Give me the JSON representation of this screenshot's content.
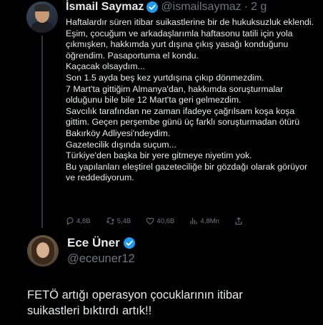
{
  "tweet1": {
    "display_name": "İsmail Saymaz",
    "handle": "@ismailsaymaz",
    "separator": "·",
    "time": "2 g",
    "paragraphs": [
      "Haftalardır süren itibar suikastlerine bir de hukuksuzluk eklendi.",
      "Eşim, çocuğum ve arkadaşlarımla haftasonu tatili için yola çıkmışken, hakkımda yurt dışına çıkış yasağı konduğunu öğrendim. Pasaportuma el kondu.",
      "Kaçacak olsaydım...",
      "Son 1.5 ayda beş kez yurtdışına çıkıp dönmezdim.",
      "7 Mart'ta gittiğim Almanya'dan, hakkımda soruşturmalar olduğunu bile bile 12 Mart'ta geri gelmezdim.",
      "Savcılık tarafından ne zaman ifadeye çağrılsam koşa koşa gittim. Geçen perşembe günü üç farklı soruşturmadan ötürü Bakırköy Adliyesi'ndeydim.",
      "Gazetecilik dışında suçum...",
      "Türkiye'den başka bir yere gitmeye niyetim yok.",
      "Bu yapılanları eleştirel gazeteciliğe bir gözdağı olarak görüyor ve reddediyorum."
    ],
    "actions": {
      "replies": "4,8B",
      "retweets": "5,4B",
      "likes": "40,6B",
      "views": "4,8Mn"
    }
  },
  "tweet2": {
    "display_name": "Ece Üner",
    "handle": "@eceuner12",
    "text_line1": "FETÖ artığı operasyon çocuklarının itibar",
    "text_line2": "suikastleri bıktırdı artık!!"
  },
  "colors": {
    "background": "#000000",
    "text": "#e7e9ea",
    "muted": "#71767b",
    "verified": "#1d9bf0",
    "thread_line": "#333639"
  },
  "icons": [
    "verified-badge-icon",
    "reply-icon",
    "retweet-icon",
    "like-icon",
    "views-icon",
    "share-icon"
  ]
}
